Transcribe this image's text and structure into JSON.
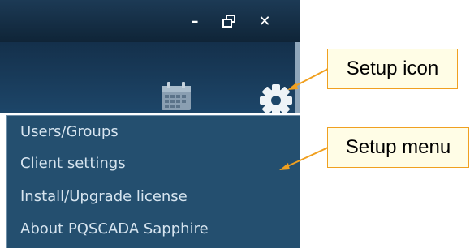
{
  "window_controls": {
    "minimize_icon": "minimize-icon",
    "restore_icon": "restore-icon",
    "close_icon": "close-icon",
    "minimize_glyph": "–",
    "close_glyph": "✕"
  },
  "toolbar": {
    "calendar_icon": "calendar-icon",
    "setup_icon": "gear-icon"
  },
  "setup_menu": {
    "items": [
      {
        "label": "Users/Groups"
      },
      {
        "label": "Client settings"
      },
      {
        "label": "Install/Upgrade license"
      },
      {
        "label": "About PQSCADA Sapphire"
      }
    ]
  },
  "callouts": {
    "setup_icon_label": "Setup icon",
    "setup_menu_label": "Setup menu"
  },
  "colors": {
    "titlebar": "#0f2437",
    "toolbar": "#1d4669",
    "menu_background": "#244f6f",
    "menu_text": "#d6e4ef",
    "callout_border": "#f0a020",
    "callout_fill": "#fffde6"
  }
}
